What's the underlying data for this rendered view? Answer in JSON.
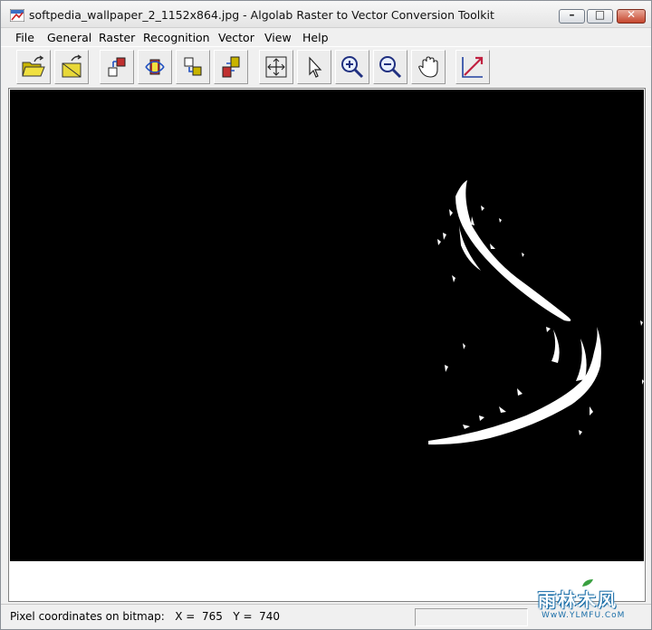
{
  "window": {
    "title": "softpedia_wallpaper_2_1152x864.jpg - Algolab Raster to Vector Conversion Toolkit",
    "controls": {
      "minimize": "–",
      "maximize": "□",
      "close": "✕"
    }
  },
  "menu": [
    "File",
    "General",
    "Raster",
    "Recognition",
    "Vector",
    "View",
    "Help"
  ],
  "toolbar": [
    {
      "name": "open-file-icon"
    },
    {
      "name": "open-vector-icon"
    },
    {
      "name": "raster-transform-icon"
    },
    {
      "name": "rotate-raster-icon"
    },
    {
      "name": "recognition-icon"
    },
    {
      "name": "vectorize-icon"
    },
    {
      "name": "fit-window-icon"
    },
    {
      "name": "select-pointer-icon"
    },
    {
      "name": "zoom-in-icon"
    },
    {
      "name": "zoom-out-icon"
    },
    {
      "name": "pan-hand-icon"
    },
    {
      "name": "vector-edit-icon"
    }
  ],
  "status": {
    "label": "Pixel coordinates on bitmap:",
    "x_label": "X =",
    "x_value": "765",
    "y_label": "Y =",
    "y_value": "740"
  },
  "watermark": {
    "text": "雨林木风",
    "url": "WwW.YLMFU.CoM"
  },
  "colors": {
    "canvas_background": "#000000",
    "foreground": "#ffffff",
    "close_button": "#c5452c",
    "watermark": "#1a6ea8"
  }
}
